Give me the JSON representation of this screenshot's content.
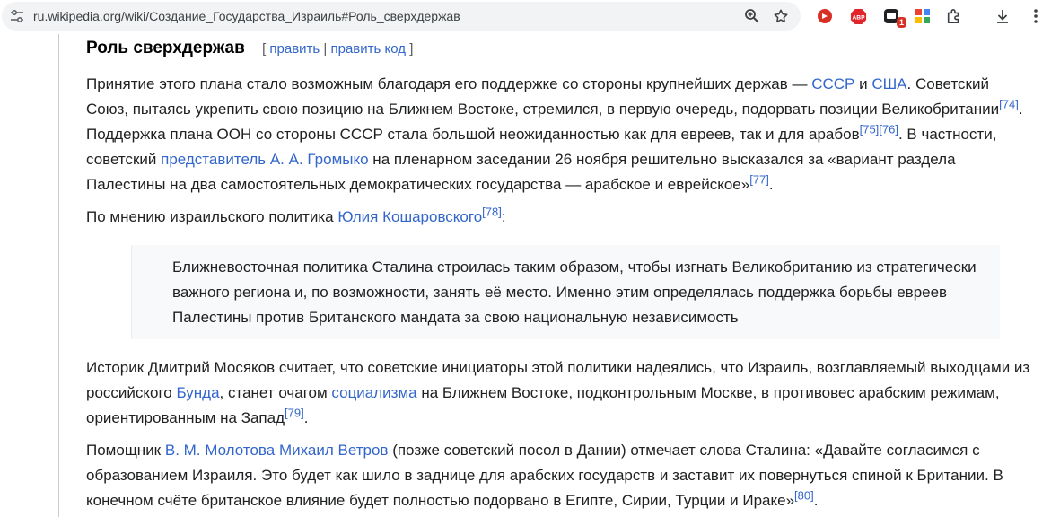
{
  "browser": {
    "url": "ru.wikipedia.org/wiki/Создание_Государства_Израиль#Роль_сверхдержав",
    "extension_badge": "1",
    "icons": [
      "site-info-icon",
      "zoom-icon",
      "star-icon",
      "extension-red-icon",
      "adblock-icon",
      "extension-dark-icon",
      "extension-grid-icon",
      "puzzle-icon",
      "download-icon",
      "menu-icon"
    ]
  },
  "section": {
    "title": "Роль сверхдержав",
    "edit_open": "[",
    "edit": "править",
    "separator": "|",
    "edit_code": "править код",
    "edit_close": "]"
  },
  "p1": {
    "t1": "Принятие этого плана стало возможным благодаря его поддержке со стороны крупнейших держав — ",
    "link_ussr": "СССР",
    "t2": " и ",
    "link_usa": "США",
    "t3": ". Советский Союз, пытаясь укрепить свою позицию на Ближнем Востоке, стремился, в первую очередь, подорвать позиции Великобритании",
    "ref74": "[74]",
    "t4": ". Поддержка плана ООН со стороны СССР стала большой неожиданностью как для евреев, так и для арабов",
    "ref75": "[75]",
    "ref76": "[76]",
    "t5": ". В частности, советский ",
    "link_rep": "представитель А. А. Громыко",
    "t6": " на пленарном заседании 26 ноября решительно высказался за «вариант раздела Палестины на два самостоятельных демократических государства — арабское и еврейское»",
    "ref77": "[77]",
    "t7": "."
  },
  "p2": {
    "t1": "По мнению израильского политика ",
    "link": "Юлия Кошаровского",
    "ref78": "[78]",
    "t2": ":"
  },
  "quote": {
    "text": "Ближневосточная политика Сталина строилась таким образом, чтобы изгнать Великобританию из стратегически важного региона и, по возможности, занять её место. Именно этим определялась поддержка борьбы евреев Палестины против Британского мандата за свою национальную независимость"
  },
  "p3": {
    "t1": "Историк Дмитрий Мосяков считает, что советские инициаторы этой политики надеялись, что Израиль, возглавляемый выходцами из российского ",
    "link_bund": "Бунда",
    "t2": ", станет очагом ",
    "link_soc": "социализма",
    "t3": " на Ближнем Востоке, подконтрольным Москве, в противовес арабским режимам, ориентированным на Запад",
    "ref79": "[79]",
    "t4": "."
  },
  "p4": {
    "t1": "Помощник ",
    "link": "В. М. Молотова Михаил Ветров",
    "t2": " (позже советский посол в Дании) отмечает слова Сталина: «Давайте согласимся с образованием Израиля. Это будет как шило в заднице для арабских государств и заставит их повернуться спиной к Британии. В конечном счёте британское влияние будет полностью подорвано в Египте, Сирии, Турции и Ираке»",
    "ref80": "[80]",
    "t3": "."
  }
}
